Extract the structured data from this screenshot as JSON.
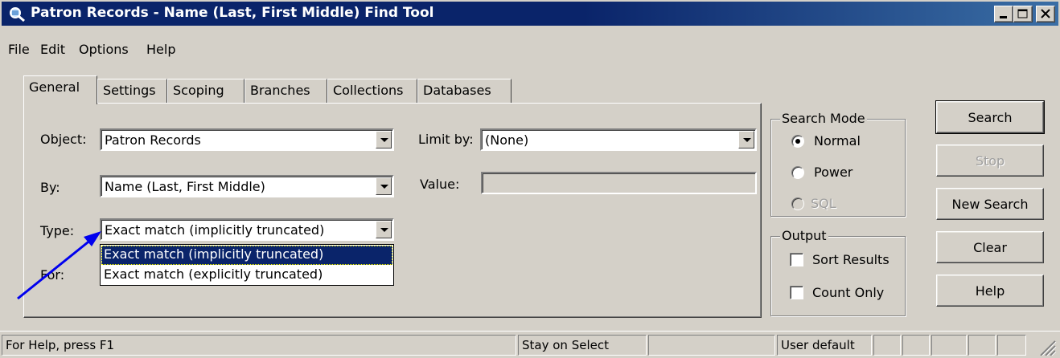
{
  "window": {
    "title": "Patron Records - Name (Last, First Middle) Find Tool",
    "title_color": "#0a246a"
  },
  "menu": [
    {
      "label": "File"
    },
    {
      "label": "Edit"
    },
    {
      "label": "Options"
    },
    {
      "label": "Help"
    }
  ],
  "tabs": [
    {
      "label": "General",
      "active": true
    },
    {
      "label": "Settings"
    },
    {
      "label": "Scoping"
    },
    {
      "label": "Branches"
    },
    {
      "label": "Collections"
    },
    {
      "label": "Databases"
    }
  ],
  "form": {
    "object_label": "Object:",
    "object_value": "Patron Records",
    "by_label": "By:",
    "by_value": "Name (Last, First Middle)",
    "type_label": "Type:",
    "type_value": "Exact match (implicitly truncated)",
    "for_label": "For:",
    "limit_label": "Limit by:",
    "limit_value": "(None)",
    "value_label": "Value:"
  },
  "type_dropdown": {
    "options": [
      "Exact match (implicitly truncated)",
      "Exact match (explicitly truncated)"
    ],
    "selected_index": 0
  },
  "search_mode": {
    "title": "Search Mode",
    "options": [
      {
        "label": "Normal",
        "checked": true,
        "enabled": true
      },
      {
        "label": "Power",
        "checked": false,
        "enabled": true
      },
      {
        "label": "SQL",
        "checked": false,
        "enabled": false
      }
    ]
  },
  "output": {
    "title": "Output",
    "options": [
      {
        "label": "Sort Results",
        "checked": false
      },
      {
        "label": "Count Only",
        "checked": false
      }
    ]
  },
  "buttons": {
    "search": "Search",
    "stop": "Stop",
    "new_search": "New Search",
    "clear": "Clear",
    "help": "Help"
  },
  "statusbar": {
    "help_text": "For Help, press F1",
    "stay_on_select": "Stay on Select",
    "user_default": "User default"
  },
  "annotation": {
    "arrow_color": "#0000ee"
  }
}
